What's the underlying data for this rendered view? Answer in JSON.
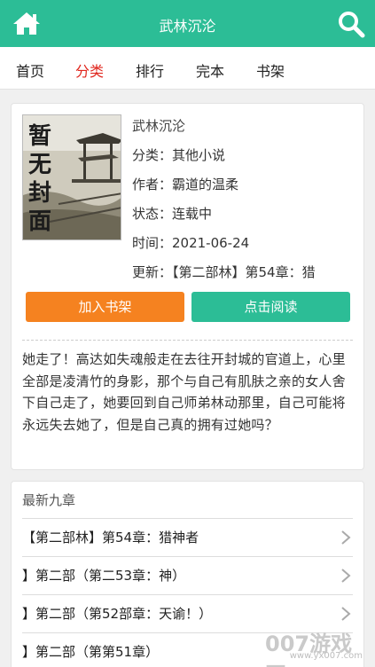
{
  "header": {
    "title": "武林沉沦",
    "home_icon": "home-icon",
    "search_icon": "search-icon",
    "bar_color": "#2cbd96"
  },
  "nav": {
    "items": [
      {
        "label": "首页"
      },
      {
        "label": "分类"
      },
      {
        "label": "排行"
      },
      {
        "label": "完本"
      },
      {
        "label": "书架"
      }
    ],
    "active_color": "#e0271e"
  },
  "book": {
    "cover_text": "暂无封面",
    "title": "武林沉沦",
    "category": "分类：其他小说",
    "author": "作者：霸道的温柔",
    "status": "状态：连载中",
    "time": "时间：2021-06-24",
    "update": "更新：【第二部林】第54章：猎",
    "add_shelf_label": "加入书架",
    "read_label": "点击阅读",
    "shelf_color": "#f58220",
    "read_color": "#2cbd96",
    "description": "她走了！高达如失魂般走在去往开封城的官道上，心里全部是凌清竹的身影，那个与自己有肌肤之亲的女人舍下自己走了，她要回到自己师弟林动那里，自己可能将永远失去她了，但是自己真的拥有过她吗？"
  },
  "chapters": {
    "heading": "最新九章",
    "items": [
      {
        "label": "【第二部林】第54章：猎神者"
      },
      {
        "label": "】第二部（第二53章：神）"
      },
      {
        "label": "】第二部（第52部章：天谕！）"
      },
      {
        "label": "】第二部（第第51章）"
      }
    ]
  },
  "watermark": {
    "text": "007游戏网",
    "url": "www.yx007.com"
  }
}
